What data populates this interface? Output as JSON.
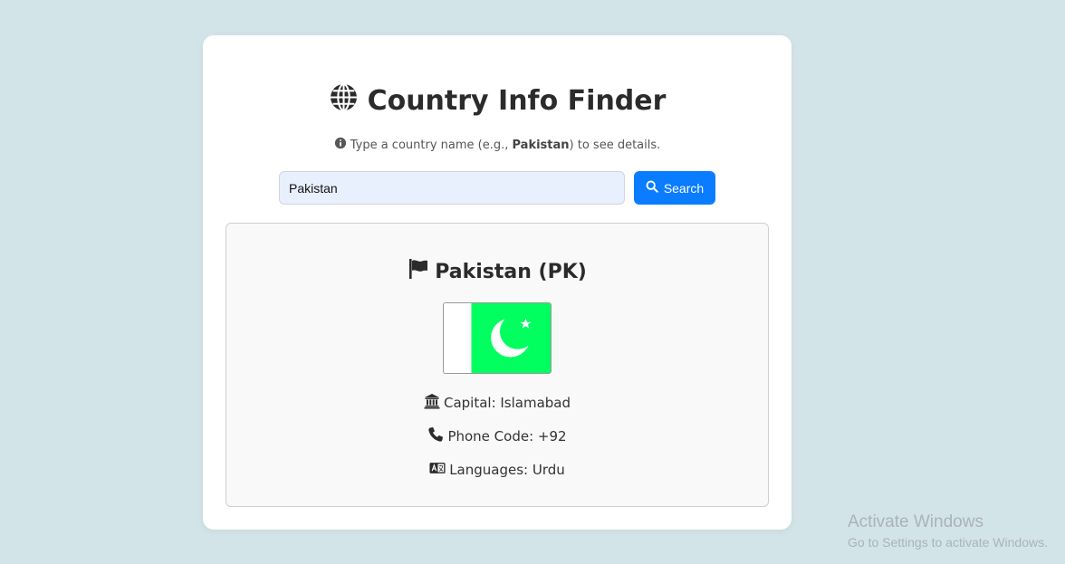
{
  "app": {
    "title": "Country Info Finder"
  },
  "hint": {
    "prefix": "Type a country name (e.g.,",
    "example": "Pakistan",
    "suffix": ") to see details."
  },
  "search": {
    "value": "Pakistan",
    "button_label": "Search"
  },
  "result": {
    "heading": "Pakistan (PK)",
    "flag_colors": {
      "white": "#ffffff",
      "green": "#01ff5f"
    },
    "capital": "Capital: Islamabad",
    "phone_code": "Phone Code: +92",
    "languages": "Languages: Urdu"
  },
  "watermark": {
    "title": "Activate Windows",
    "subtitle": "Go to Settings to activate Windows."
  },
  "colors": {
    "accent": "#0a7cff",
    "background": "#d3e4e9"
  },
  "icons": [
    "globe-icon",
    "info-icon",
    "search-icon",
    "flag-icon",
    "landmark-icon",
    "phone-icon",
    "language-icon"
  ]
}
